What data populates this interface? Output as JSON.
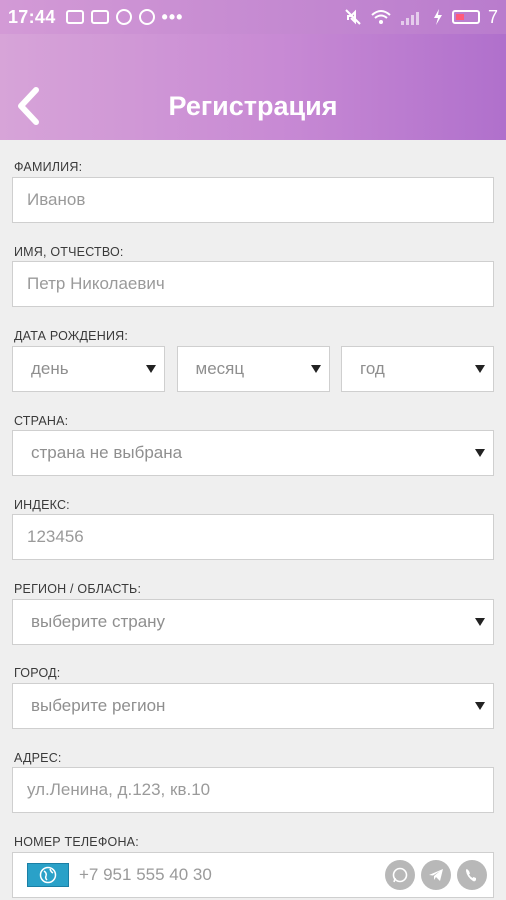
{
  "status_bar": {
    "time": "17:44",
    "icons": [
      "image-icon",
      "vk-icon",
      "check-circle-icon",
      "pause-circle-icon",
      "more-dots-icon"
    ],
    "dots": "•••",
    "battery_level": "7"
  },
  "header": {
    "title": "Регистрация",
    "back_icon": "chevron-left-icon"
  },
  "form": {
    "last_name": {
      "label": "ФАМИЛИЯ:",
      "placeholder": "Иванов"
    },
    "first_middle_name": {
      "label": "ИМЯ, ОТЧЕСТВО:",
      "placeholder": "Петр Николаевич"
    },
    "birth_date": {
      "label": "ДАТА РОЖДЕНИЯ:",
      "day": "день",
      "month": "месяц",
      "year": "год"
    },
    "country": {
      "label": "СТРАНА:",
      "value": "страна не выбрана"
    },
    "zip": {
      "label": "ИНДЕКС:",
      "placeholder": "123456"
    },
    "region": {
      "label": "РЕГИОН / ОБЛАСТЬ:",
      "value": "выберите страну"
    },
    "city": {
      "label": "ГОРОД:",
      "value": "выберите регион"
    },
    "address": {
      "label": "АДРЕС:",
      "placeholder": "ул.Ленина, д.123, кв.10"
    },
    "phone": {
      "label": "НОМЕР ТЕЛЕФОНА:",
      "placeholder": "+7 951 555 40 30",
      "messenger_icons": [
        "whatsapp-icon",
        "telegram-icon",
        "viber-icon"
      ]
    }
  },
  "colors": {
    "header_gradient_start": "#d7a4d8",
    "header_gradient_end": "#b070cc",
    "background": "#efefef",
    "field_border": "#cfcfcf",
    "flag_badge": "#2aa1c8"
  }
}
